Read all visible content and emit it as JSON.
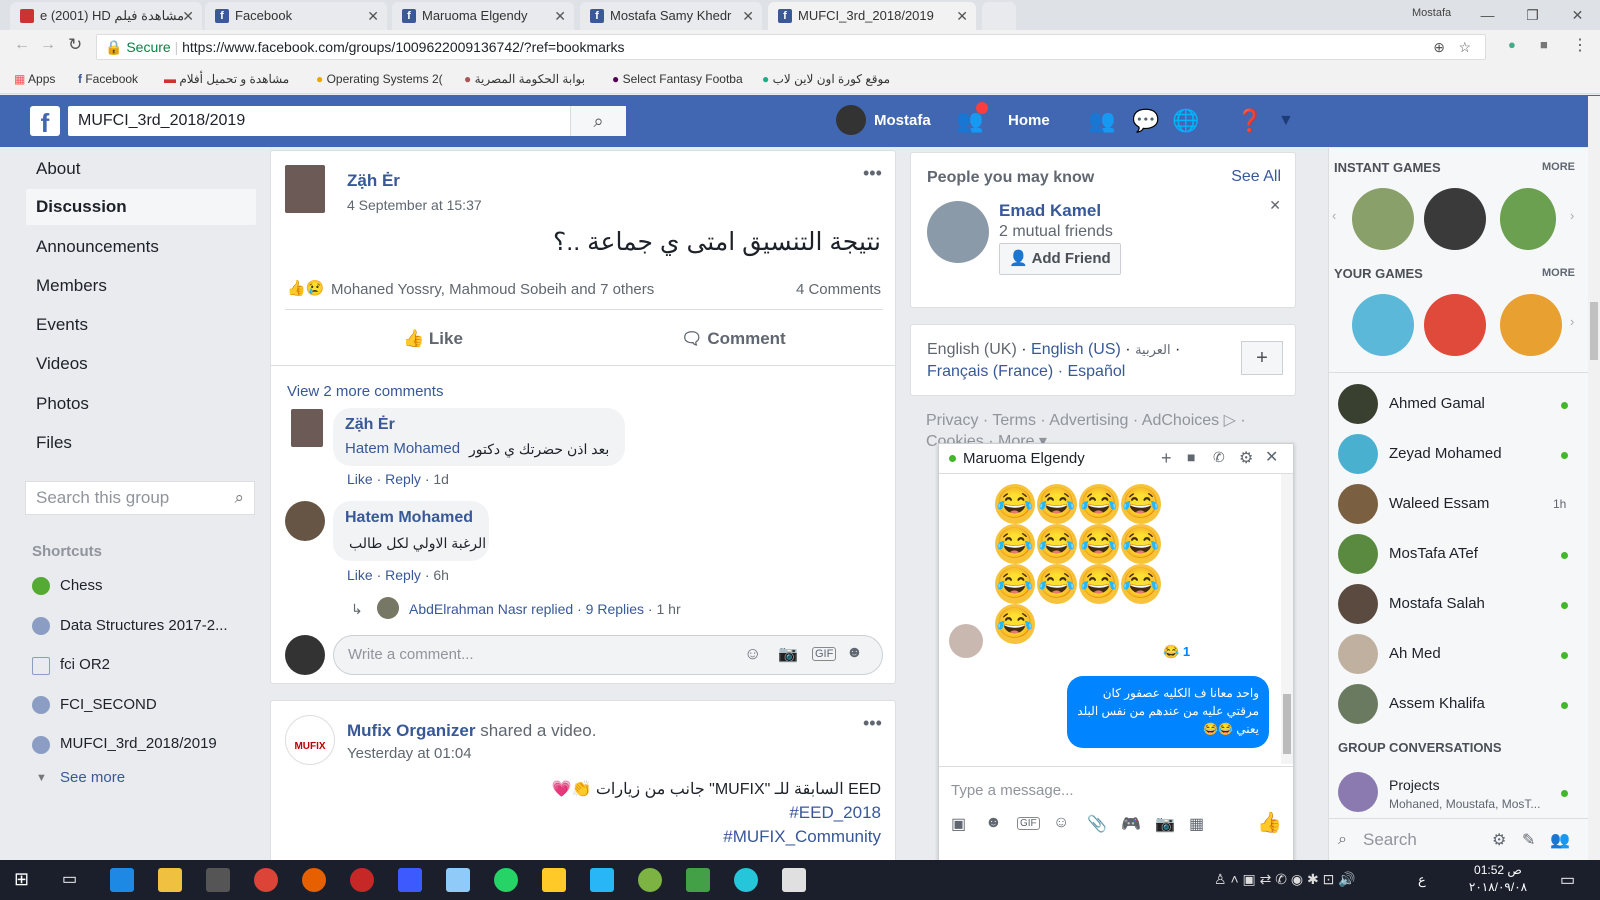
{
  "browser": {
    "tabs": [
      {
        "label": "e (2001) HD مشاهدة فيلم",
        "active": false
      },
      {
        "label": "Facebook",
        "active": false
      },
      {
        "label": "Maruoma Elgendy",
        "active": false
      },
      {
        "label": "Mostafa Samy Khedr",
        "active": false
      },
      {
        "label": "MUFCI_3rd_2018/2019",
        "active": true
      }
    ],
    "window_user": "Mostafa",
    "secure_label": "Secure",
    "url": "https://www.facebook.com/groups/1009622009136742/?ref=bookmarks",
    "bookmarks": [
      "Apps",
      "Facebook",
      "مشاهدة و تحميل أفلام",
      "Operating Systems 2(",
      "بوابة الحكومة المصرية",
      "Select Fantasy Footba",
      "موقع كورة اون لاين لاب"
    ]
  },
  "fb": {
    "search_value": "MUFCI_3rd_2018/2019",
    "user": "Mostafa",
    "home": "Home"
  },
  "left": {
    "nav": [
      "About",
      "Discussion",
      "Announcements",
      "Members",
      "Events",
      "Videos",
      "Photos",
      "Files"
    ],
    "search_placeholder": "Search this group",
    "shortcuts_title": "Shortcuts",
    "shortcuts": [
      "Chess",
      "Data Structures 2017-2...",
      "fci OR2",
      "FCI_SECOND",
      "MUFCI_3rd_2018/2019"
    ],
    "see_more": "See more"
  },
  "post1": {
    "author": "Zạ̈h Ėr",
    "time": "4 September at 15:37",
    "text": "نتيجة التنسيق امتى ي جماعة ..؟",
    "reactions": "Mohaned Yossry, Mahmoud Sobeih and 7 others",
    "comments_count": "4 Comments",
    "like": "Like",
    "comment": "Comment",
    "view_more": "View 2 more comments",
    "c1": {
      "author": "Zạ̈h Ėr",
      "mention": "Hatem Mohamed",
      "text": "بعد اذن حضرتك ي دكتور",
      "meta_like": "Like",
      "meta_reply": "Reply",
      "time": "1d"
    },
    "c2": {
      "author": "Hatem Mohamed",
      "text": "الرغبة الاولي لكل طالب",
      "meta_like": "Like",
      "meta_reply": "Reply",
      "time": "6h"
    },
    "reply": {
      "who": "AbdElrahman Nasr replied",
      "count": "9 Replies",
      "time": "1 hr"
    },
    "write_placeholder": "Write a comment..."
  },
  "post2": {
    "author": "Mufix Organizer",
    "action": "shared a video.",
    "time": "Yesterday at 01:04",
    "line1": "جانب من زيارات \"MUFIX\" السابقة للـ EED",
    "tag1": "#EED_2018",
    "tag2": "#MUFIX_Community",
    "logo_text": "MUFIX"
  },
  "pymk": {
    "title": "People you may know",
    "see_all": "See All",
    "name": "Emad Kamel",
    "mutual": "2 mutual friends",
    "add": "Add Friend"
  },
  "lang": {
    "l1": "English (UK)",
    "l2": "English (US)",
    "l3": "العربية",
    "l4": "Français (France)",
    "l5": "Español"
  },
  "footer": {
    "privacy": "Privacy",
    "terms": "Terms",
    "advertising": "Advertising",
    "adchoices": "AdChoices",
    "cookies": "Cookies",
    "more": "More"
  },
  "chat": {
    "name": "Maruoma Elgendy",
    "reaction_count": "1",
    "msg": "واحد معانا ف الكليه عصفور كان مرقتي عليه من عندهم من نفس البلد يعني 😂😂",
    "placeholder": "Type a message..."
  },
  "rightcol": {
    "instant_games": "INSTANT GAMES",
    "your_games": "YOUR GAMES",
    "more": "MORE",
    "friends": [
      {
        "name": "Ahmed Gamal",
        "status": ""
      },
      {
        "name": "Zeyad Mohamed",
        "status": ""
      },
      {
        "name": "Waleed Essam",
        "status": "1h"
      },
      {
        "name": "MosTafa ATef",
        "status": ""
      },
      {
        "name": "Mostafa Salah",
        "status": ""
      },
      {
        "name": "Ah Med",
        "status": ""
      },
      {
        "name": "Assem Khalifa",
        "status": ""
      }
    ],
    "group_conv": "GROUP CONVERSATIONS",
    "projects": "Projects",
    "projects_sub": "Mohaned, Moustafa, MosT...",
    "search": "Search"
  },
  "taskbar": {
    "time": "01:52 ص",
    "date": "٢٠١٨/٠٩/٠٨",
    "lang": "ع"
  },
  "colors": {
    "fb_blue": "#4267b2",
    "link": "#385898",
    "online": "#42b72a",
    "chat_bubble": "#0084ff"
  }
}
